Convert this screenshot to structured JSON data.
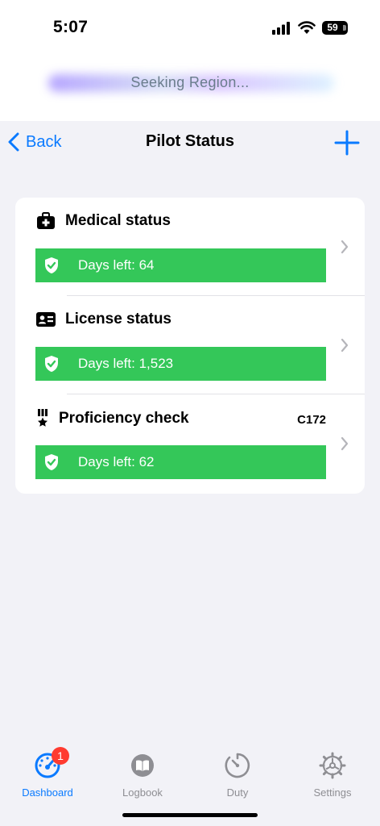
{
  "status_bar": {
    "time": "5:07",
    "battery": "59"
  },
  "banner": {
    "text": "Seeking Region..."
  },
  "nav": {
    "back_label": "Back",
    "title": "Pilot Status"
  },
  "items": [
    {
      "title": "Medical status",
      "tag": "",
      "days": "Days left: 64",
      "icon": "medical-kit-icon"
    },
    {
      "title": "License status",
      "tag": "",
      "days": "Days left: 1,523",
      "icon": "id-card-icon"
    },
    {
      "title": "Proficiency check",
      "tag": "C172",
      "days": "Days left: 62",
      "icon": "medal-icon"
    }
  ],
  "tabs": [
    {
      "label": "Dashboard",
      "badge": "1",
      "active": true,
      "icon": "speedometer-icon"
    },
    {
      "label": "Logbook",
      "badge": "",
      "active": false,
      "icon": "book-icon"
    },
    {
      "label": "Duty",
      "badge": "",
      "active": false,
      "icon": "timer-icon"
    },
    {
      "label": "Settings",
      "badge": "",
      "active": false,
      "icon": "gear-icon"
    }
  ],
  "colors": {
    "accent": "#0a7aff",
    "status_green": "#34c759",
    "badge_red": "#ff3b30"
  }
}
